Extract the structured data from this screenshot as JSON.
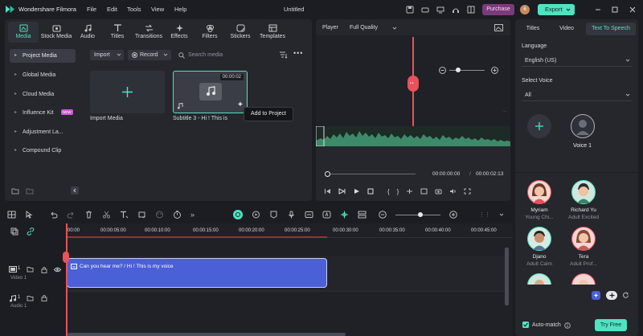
{
  "app": {
    "title": "Wondershare Filmora",
    "project_title": "Untitled",
    "menu": [
      "File",
      "Edit",
      "Tools",
      "View",
      "Help"
    ],
    "purchase_label": "Purchase",
    "avatar_letter": "6",
    "export_label": "Export"
  },
  "media_tabs": [
    {
      "label": "Media",
      "icon": "media-icon",
      "active": true
    },
    {
      "label": "Stock Media",
      "icon": "stock-media-icon"
    },
    {
      "label": "Audio",
      "icon": "music-note-icon"
    },
    {
      "label": "Titles",
      "icon": "titles-icon"
    },
    {
      "label": "Transitions",
      "icon": "transitions-icon"
    },
    {
      "label": "Effects",
      "icon": "effects-icon"
    },
    {
      "label": "Filters",
      "icon": "filters-icon"
    },
    {
      "label": "Stickers",
      "icon": "stickers-icon"
    },
    {
      "label": "Templates",
      "icon": "templates-icon"
    }
  ],
  "media_sidebar": [
    {
      "label": "Project Media",
      "active": true
    },
    {
      "label": "Global Media"
    },
    {
      "label": "Cloud Media"
    },
    {
      "label": "Influence Kit",
      "badge": "NEW"
    },
    {
      "label": "Adjustment La..."
    },
    {
      "label": "Compound Clip"
    }
  ],
  "media_toolbar": {
    "import_label": "Import",
    "record_label": "Record",
    "search_placeholder": "Search media"
  },
  "media_items": {
    "import_label": "Import Media",
    "clip_duration": "00:00:02",
    "clip_name": "Subtitle 3 - Hi ! This is",
    "tooltip": "Add to Project"
  },
  "player": {
    "label": "Player",
    "quality": "Full Quality",
    "current_time": "00:00:00:00",
    "separator": "/",
    "total_time": "00:00:02:13",
    "progress": 0
  },
  "tts": {
    "tabs": [
      "Titles",
      "Video",
      "Text To Speech"
    ],
    "active_tab": 2,
    "language_label": "Language",
    "language_value": "English (US)",
    "voice_label": "Select Voice",
    "voice_filter": "All",
    "custom_voice_name": "Voice 1",
    "voices": [
      {
        "name": "Myriam",
        "desc": "Young Chi...",
        "skin": "#f2c4a8",
        "hair": "#6b3a2a",
        "bg": "#f4d7d0"
      },
      {
        "name": "Richard Yu",
        "desc": "Adult Excited",
        "skin": "#efc2a0",
        "hair": "#2b2b2b",
        "bg": "#cfe7dd"
      },
      {
        "name": "Djano",
        "desc": "Adult Calm",
        "skin": "#c98f6c",
        "hair": "#2a2020",
        "bg": "#d5ebe4"
      },
      {
        "name": "Tera",
        "desc": "Adult Prof...",
        "skin": "#f0c6a8",
        "hair": "#8a4a34",
        "bg": "#f4d4d4"
      }
    ],
    "auto_match_label": "Auto-match",
    "try_free_label": "Try Free"
  },
  "timeline": {
    "ruler": [
      "00:00",
      "00:00:05:00",
      "00:00:10:00",
      "00:00:15:00",
      "00:00:20:00",
      "00:00:25:00",
      "00:00:30:00",
      "00:00:35:00",
      "00:00:40:00",
      "00:00:45:00"
    ],
    "video_track_label": "Video 1",
    "video_track_num": "1",
    "audio_track_label": "Audio 1",
    "audio_track_num": "1",
    "clip_text": "Can you hear me? / Hi ! This is my voice"
  },
  "colors": {
    "accent": "#4fe3c1",
    "playhead": "#e8525a",
    "clip": "#4b5fd6",
    "purchase": "#7a3b7a"
  }
}
